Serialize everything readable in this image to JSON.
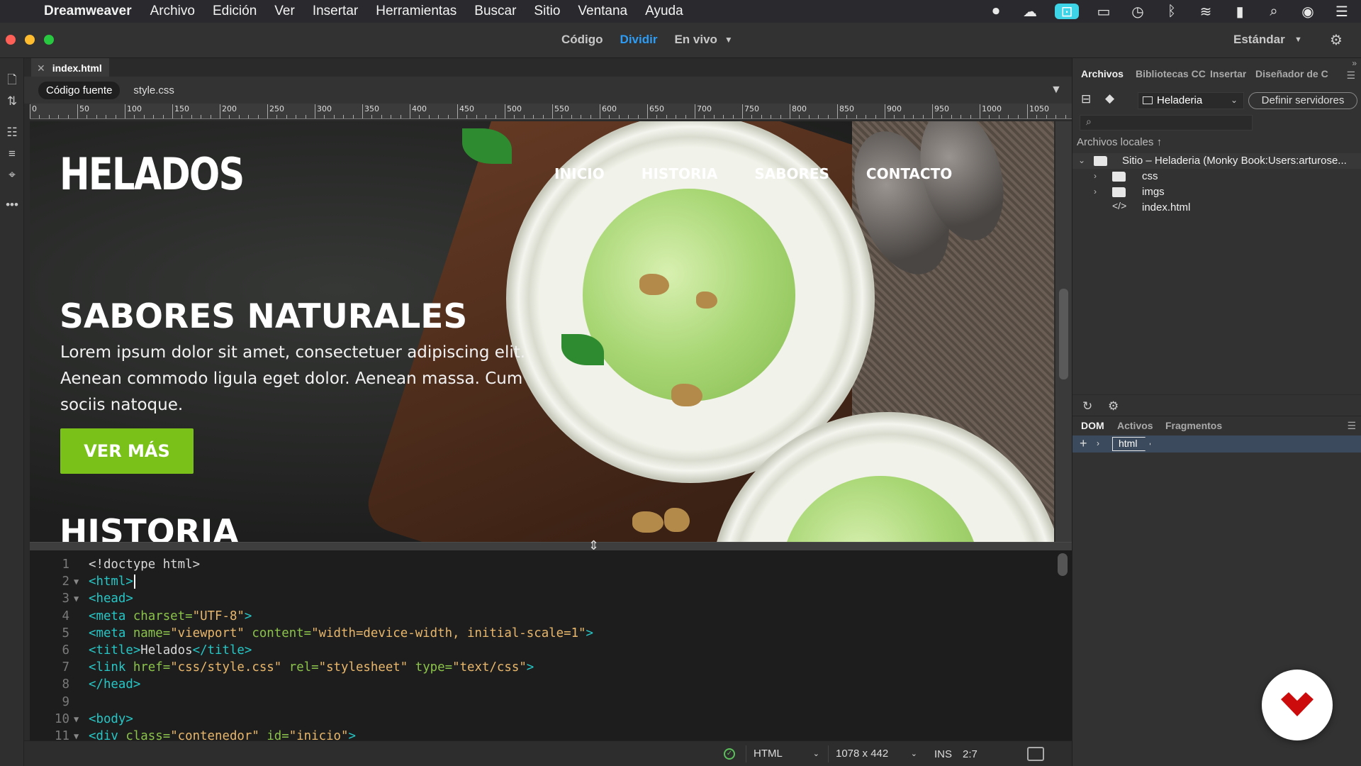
{
  "menubar": {
    "app_name": "Dreamweaver",
    "items": [
      "Archivo",
      "Edición",
      "Ver",
      "Insertar",
      "Herramientas",
      "Buscar",
      "Sitio",
      "Ventana",
      "Ayuda"
    ],
    "status_icons": [
      "stop-record-icon",
      "cloud-icon",
      "badge-app-icon",
      "display-icon",
      "time-machine-icon",
      "bluetooth-icon",
      "wifi-icon",
      "battery-icon",
      "spotlight-icon",
      "siri-icon",
      "notification-center-icon"
    ]
  },
  "titlebar": {
    "view_modes": [
      "Código",
      "Dividir",
      "En vivo"
    ],
    "active_mode": "Dividir",
    "workspace": "Estándar",
    "traffic_colors": [
      "#fe5f57",
      "#febc2e",
      "#28c840"
    ]
  },
  "document": {
    "tab": "index.html",
    "related_files": [
      "Código fuente",
      "style.css"
    ]
  },
  "ruler": {
    "labels": [
      "0",
      "50",
      "100",
      "150",
      "200",
      "250",
      "300",
      "350",
      "400",
      "450",
      "500",
      "550",
      "600",
      "650",
      "700",
      "750",
      "800",
      "850",
      "900",
      "950",
      "1000",
      "1050"
    ]
  },
  "live": {
    "logo": "HELADOS",
    "nav": [
      "INICIO",
      "HISTORIA",
      "SABORES",
      "CONTACTO"
    ],
    "hero_title": "SABORES NATURALES",
    "hero_text": "Lorem ipsum dolor sit amet, consectetuer adipiscing elit. Aenean commodo ligula eget dolor. Aenean massa. Cum sociis natoque.",
    "hero_button": "VER MÁS",
    "section_title": "HISTORIA",
    "accent": "#7ac21a"
  },
  "code": {
    "lines": [
      {
        "n": "1",
        "fold": "",
        "parts": [
          [
            "tx",
            "<!doctype html>"
          ]
        ]
      },
      {
        "n": "2",
        "fold": "▼",
        "parts": [
          [
            "tg",
            "<html>"
          ]
        ],
        "cursor": true
      },
      {
        "n": "3",
        "fold": "▼",
        "parts": [
          [
            "tg",
            "<head>"
          ]
        ]
      },
      {
        "n": "4",
        "fold": "",
        "parts": [
          [
            "tg",
            "<meta "
          ],
          [
            "at",
            "charset="
          ],
          [
            "vl",
            "\"UTF-8\""
          ],
          [
            "tg",
            ">"
          ]
        ]
      },
      {
        "n": "5",
        "fold": "",
        "parts": [
          [
            "tg",
            "<meta "
          ],
          [
            "at",
            "name="
          ],
          [
            "vl",
            "\"viewport\" "
          ],
          [
            "at",
            "content="
          ],
          [
            "vl",
            "\"width=device-width, initial-scale=1\""
          ],
          [
            "tg",
            ">"
          ]
        ]
      },
      {
        "n": "6",
        "fold": "",
        "parts": [
          [
            "tg",
            "<title>"
          ],
          [
            "tx",
            "Helados"
          ],
          [
            "tg",
            "</title>"
          ]
        ]
      },
      {
        "n": "7",
        "fold": "",
        "parts": [
          [
            "tg",
            "<link "
          ],
          [
            "at",
            "href="
          ],
          [
            "vl",
            "\"css/style.css\" "
          ],
          [
            "at",
            "rel="
          ],
          [
            "vl",
            "\"stylesheet\" "
          ],
          [
            "at",
            "type="
          ],
          [
            "vl",
            "\"text/css\""
          ],
          [
            "tg",
            ">"
          ]
        ]
      },
      {
        "n": "8",
        "fold": "",
        "parts": [
          [
            "tg",
            "</head>"
          ]
        ]
      },
      {
        "n": "9",
        "fold": "",
        "parts": []
      },
      {
        "n": "10",
        "fold": "▼",
        "parts": [
          [
            "tg",
            "<body>"
          ]
        ]
      },
      {
        "n": "11",
        "fold": "▼",
        "parts": [
          [
            "tg",
            "<div "
          ],
          [
            "at",
            "class="
          ],
          [
            "vl",
            "\"contenedor\" "
          ],
          [
            "at",
            "id="
          ],
          [
            "vl",
            "\"inicio\""
          ],
          [
            "tg",
            ">"
          ]
        ]
      }
    ]
  },
  "statusbar": {
    "language": "HTML",
    "size": "1078 x 442",
    "mode": "INS",
    "position": "2:7"
  },
  "files_panel": {
    "tabs": [
      "Archivos",
      "Bibliotecas CC",
      "Insertar",
      "Diseñador de C"
    ],
    "site": "Heladeria",
    "define_servers": "Definir servidores",
    "local_label": "Archivos locales",
    "site_root": "Sitio – Heladeria (Monky Book:Users:arturose...",
    "items": [
      "css",
      "imgs",
      "index.html"
    ]
  },
  "dom_panel": {
    "tabs": [
      "DOM",
      "Activos",
      "Fragmentos"
    ],
    "root_tag": "html"
  }
}
